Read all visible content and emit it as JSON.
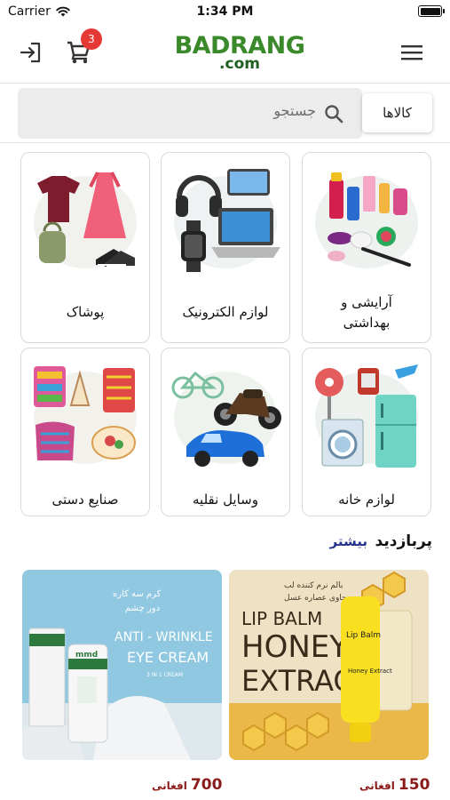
{
  "status_bar": {
    "carrier": "Carrier",
    "time": "1:34 PM"
  },
  "header": {
    "logo_main": "BADRANG",
    "logo_sub": ".com",
    "cart_count": "3",
    "icons": [
      "login-icon",
      "cart-icon",
      "menu-icon"
    ]
  },
  "search": {
    "placeholder": "جستجو",
    "category_label": "کالاها"
  },
  "categories": [
    {
      "label": "آرایشی و بهداشتی",
      "label_line1": "آرایشی و",
      "label_line2": "بهداشتی"
    },
    {
      "label": "لوازم الکترونیک"
    },
    {
      "label": "پوشاک"
    },
    {
      "label": "لوازم خانه"
    },
    {
      "label": "وسایل نقلیه"
    },
    {
      "label": "صنایع دستی"
    }
  ],
  "section": {
    "title": "پربازدید",
    "more": "بیشتر"
  },
  "products": [
    {
      "price": "150",
      "currency": "افغانی",
      "image_text": {
        "top": "بالم نرم کننده لب",
        "top2": "حاوی عصاره عسل",
        "line1": "LIP BALM",
        "line2": "HONEY",
        "line3": "EXTRACT",
        "tube_brand": "Lip Balm",
        "tube_sub": "Honey Extract"
      }
    },
    {
      "price": "700",
      "currency": "افغانی",
      "image_text": {
        "top": "کرم سه کاره",
        "top2": "دور چشم",
        "line1": "ANTI - WRINKLE",
        "line2": "EYE CREAM",
        "line3": "3 IN 1 CREAM",
        "tube_brand": "mmd"
      }
    }
  ],
  "colors": {
    "brand_green": "#3a8a2b",
    "badge_red": "#e53935",
    "price": "#8b1a1a",
    "more_link": "#25328a"
  }
}
